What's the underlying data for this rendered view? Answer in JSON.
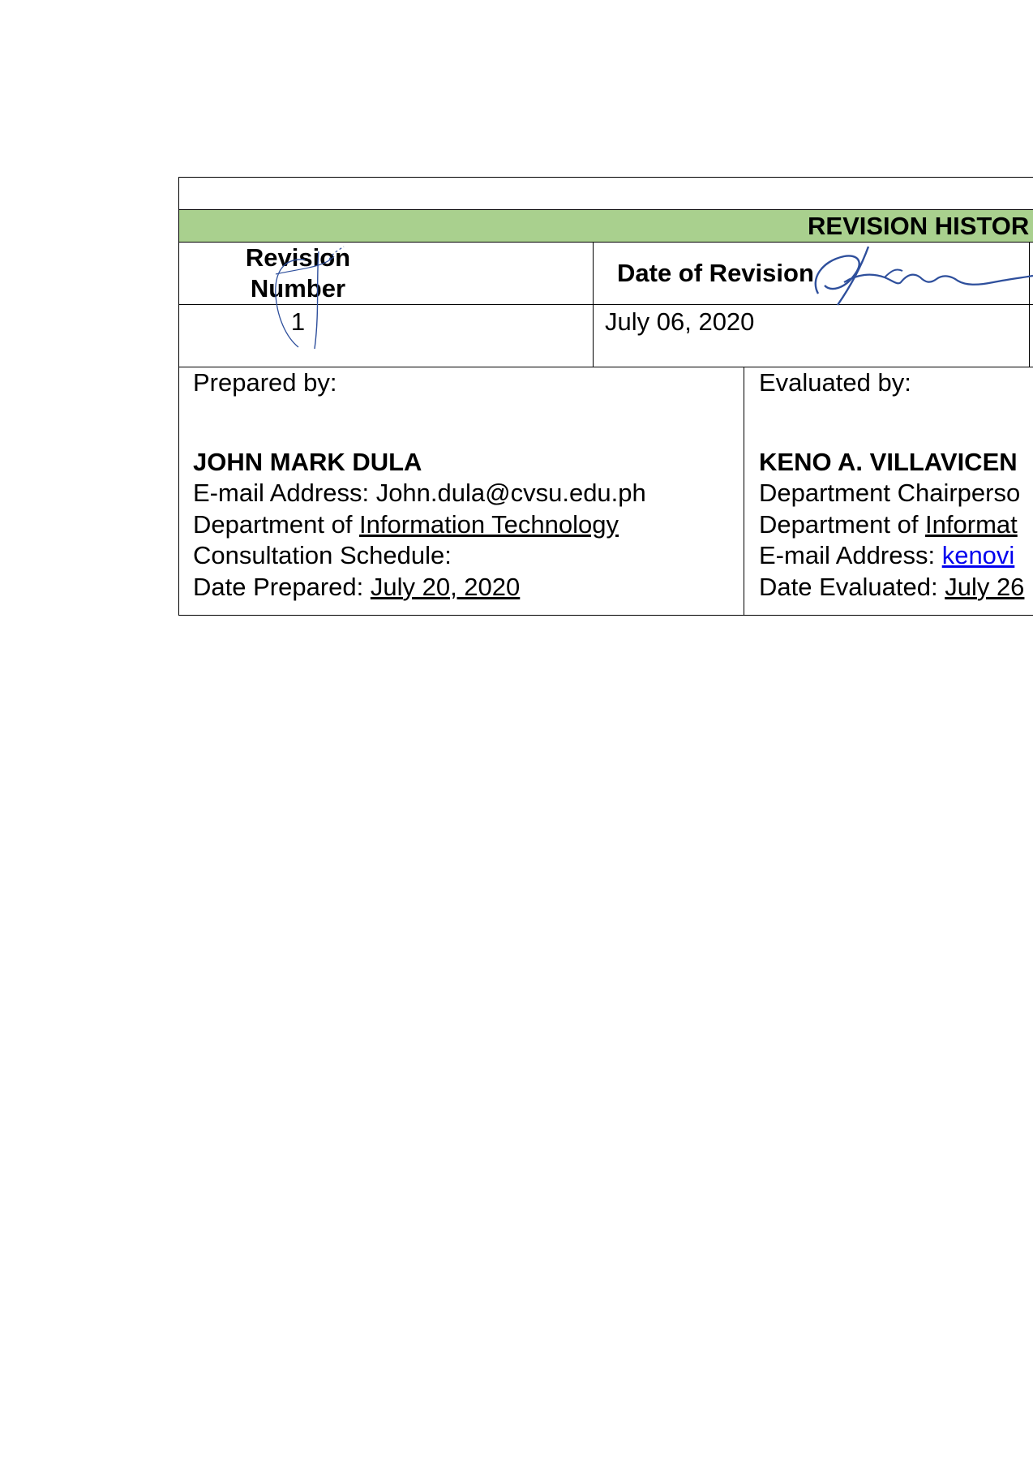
{
  "revision_history": {
    "title": "REVISION HISTOR",
    "headers": {
      "revision_number": [
        "Revision",
        "Number"
      ],
      "date_of_revision": "Date of Revision"
    },
    "rows": [
      {
        "revision_number": "1",
        "date_of_revision": "July 06, 2020"
      }
    ]
  },
  "prepared": {
    "label": "Prepared by:",
    "name": "JOHN MARK DULA",
    "email_line": "E-mail Address: John.dula@cvsu.edu.ph",
    "dept_prefix": "Department of ",
    "dept_name": "Information Technology",
    "consultation": "Consultation Schedule:",
    "date_prefix": "Date Prepared: ",
    "date_value": "July 20, 2020"
  },
  "evaluated": {
    "label": "Evaluated by:",
    "name": "KENO A. VILLAVICEN",
    "position": "Department Chairperso",
    "dept_prefix": "Department of ",
    "dept_name": "Informat",
    "email_prefix": "E-mail Address: ",
    "email_value": "kenovi",
    "date_prefix": "Date Evaluated: ",
    "date_value": "July 26"
  },
  "colors": {
    "banner": "#a9d08e",
    "link": "#0000ee",
    "signature_ink": "#2e4f9c"
  }
}
